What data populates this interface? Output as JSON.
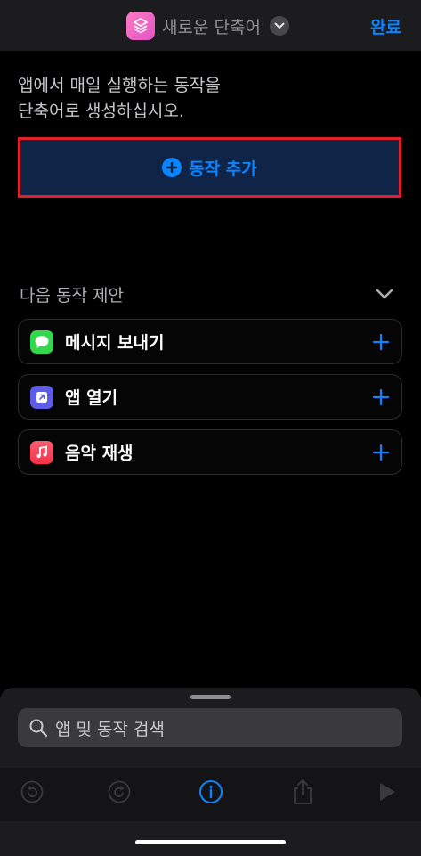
{
  "header": {
    "title": "새로운 단축어",
    "done_label": "완료",
    "app_icon": "shortcuts-icon",
    "chevron_icon": "chevron-down-icon"
  },
  "intro": {
    "line1": "앱에서 매일 실행하는 동작을",
    "line2": "단축어로 생성하십시오."
  },
  "add_action": {
    "label": "동작 추가",
    "icon": "plus-circle-icon",
    "highlight_color": "#e0202a"
  },
  "suggestions": {
    "header": "다음 동작 제안",
    "items": [
      {
        "label": "메시지 보내기",
        "icon": "messages-app-icon"
      },
      {
        "label": "앱 열기",
        "icon": "open-app-icon"
      },
      {
        "label": "음악 재생",
        "icon": "music-app-icon"
      }
    ]
  },
  "search": {
    "placeholder": "앱 및 동작 검색"
  },
  "toolbar": {
    "buttons": [
      "undo-icon",
      "redo-icon",
      "info-icon",
      "share-icon",
      "play-icon"
    ]
  },
  "colors": {
    "accent": "#0a84ff",
    "background": "#000000",
    "sheet": "#1c1c1e"
  }
}
